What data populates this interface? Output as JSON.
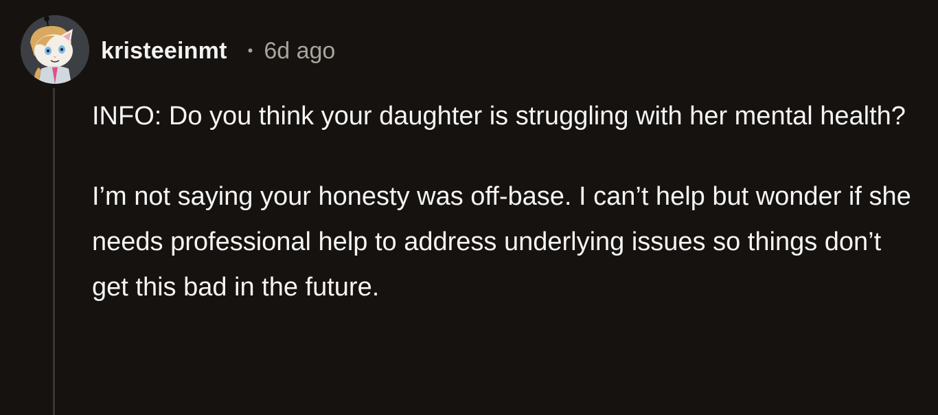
{
  "comment": {
    "author": "kristeeinmt",
    "separator": "•",
    "timestamp": "6d ago",
    "avatar_icon": "cat-avatar-icon",
    "paragraphs": [
      "INFO: Do you think your daughter is struggling with her mental health?",
      "I’m not saying your honesty was off-base. I can’t help but wonder if she needs professional help to address underlying issues so things don’t get this bad in the future."
    ]
  },
  "colors": {
    "background": "#16120f",
    "text": "#f5f5f5",
    "muted": "#a9a39d",
    "thread_line": "#3a3633"
  }
}
